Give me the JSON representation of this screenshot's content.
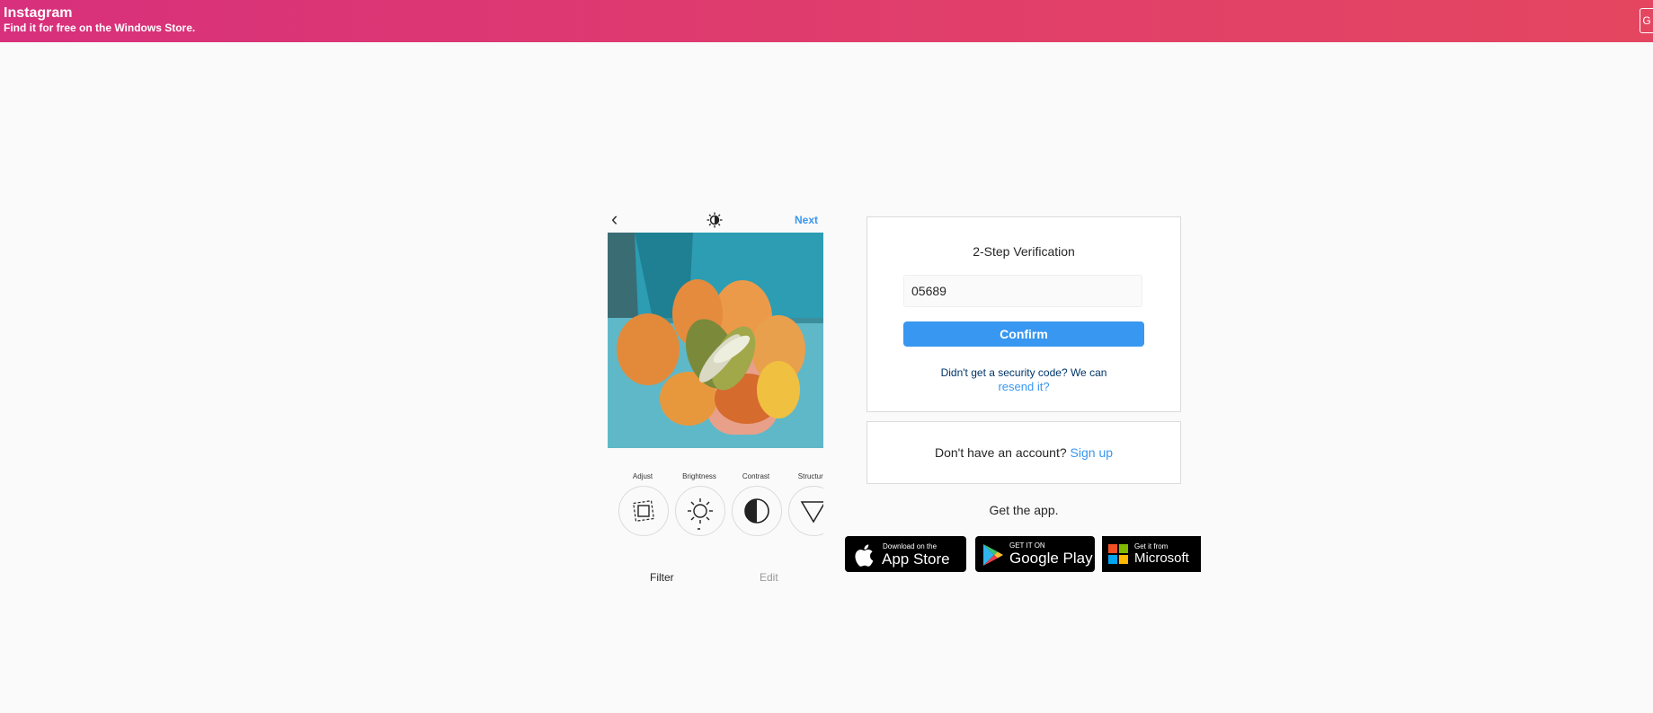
{
  "banner": {
    "app_name": "Instagram",
    "subtitle": "Find it for free on the Windows Store."
  },
  "preview": {
    "next_label": "Next",
    "tools": [
      {
        "label": "Adjust",
        "icon": "adjust-icon"
      },
      {
        "label": "Brightness",
        "icon": "brightness-icon"
      },
      {
        "label": "Contrast",
        "icon": "contrast-icon"
      },
      {
        "label": "Structure",
        "icon": "structure-icon"
      }
    ],
    "tab_filter": "Filter",
    "tab_edit": "Edit"
  },
  "verification": {
    "title": "2-Step Verification",
    "code_value": "05689",
    "confirm_label": "Confirm",
    "resend_text": "Didn't get a security code? We can",
    "resend_link": "resend it?"
  },
  "signup": {
    "text": "Don't have an account?",
    "link": "Sign up"
  },
  "get_app": "Get the app.",
  "badges": {
    "appstore_small": "Download on the",
    "appstore_big": "App Store",
    "gplay_small": "GET IT ON",
    "gplay_big": "Google Play",
    "ms_small": "Get it from",
    "ms_big": "Microsoft"
  },
  "colors": {
    "accent": "#3897f0",
    "banner_start": "#d8307c",
    "banner_end": "#e44660"
  }
}
